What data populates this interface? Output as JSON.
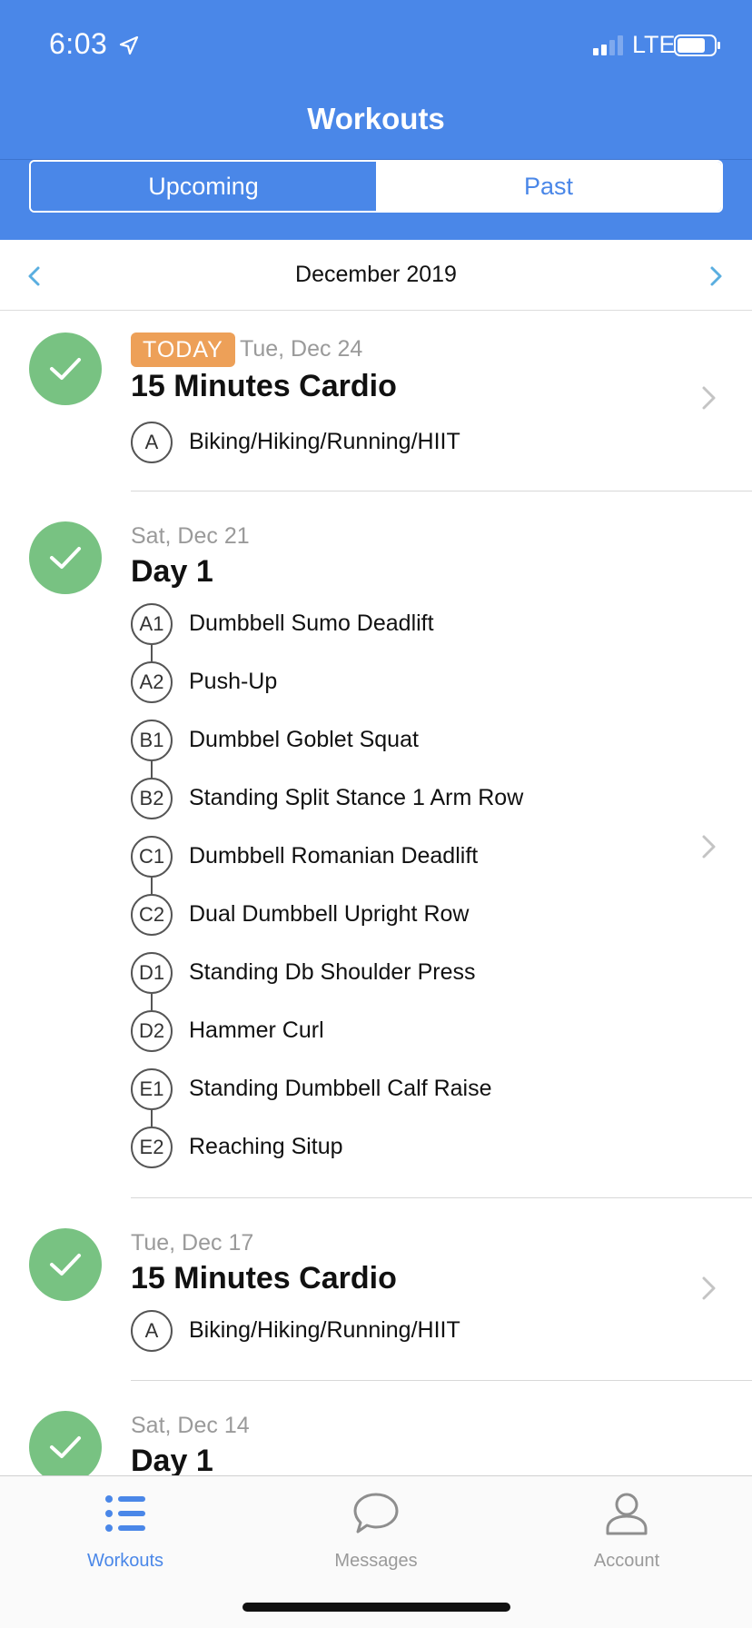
{
  "status_bar": {
    "time": "6:03",
    "network": "LTE"
  },
  "header": {
    "title": "Workouts"
  },
  "segments": {
    "upcoming": "Upcoming",
    "past": "Past"
  },
  "month_nav": {
    "label": "December 2019"
  },
  "workouts": [
    {
      "badge": "TODAY",
      "date": "Tue, Dec 24",
      "title": "15 Minutes Cardio",
      "exercises": [
        {
          "tag": "A",
          "name": "Biking/Hiking/Running/HIIT"
        }
      ]
    },
    {
      "date": "Sat, Dec 21",
      "title": "Day 1",
      "exercises": [
        {
          "tag": "A1",
          "name": "Dumbbell Sumo Deadlift"
        },
        {
          "tag": "A2",
          "name": "Push-Up"
        },
        {
          "tag": "B1",
          "name": "Dumbbel Goblet Squat"
        },
        {
          "tag": "B2",
          "name": "Standing Split Stance 1 Arm Row"
        },
        {
          "tag": "C1",
          "name": "Dumbbell Romanian Deadlift"
        },
        {
          "tag": "C2",
          "name": "Dual Dumbbell Upright Row"
        },
        {
          "tag": "D1",
          "name": "Standing Db Shoulder Press"
        },
        {
          "tag": "D2",
          "name": "Hammer Curl"
        },
        {
          "tag": "E1",
          "name": "Standing Dumbbell Calf Raise"
        },
        {
          "tag": "E2",
          "name": "Reaching Situp"
        }
      ]
    },
    {
      "date": "Tue, Dec 17",
      "title": "15 Minutes Cardio",
      "exercises": [
        {
          "tag": "A",
          "name": "Biking/Hiking/Running/HIIT"
        }
      ]
    },
    {
      "date": "Sat, Dec 14",
      "title": "Day 1",
      "exercises": []
    }
  ],
  "tabbar": {
    "workouts": "Workouts",
    "messages": "Messages",
    "account": "Account"
  },
  "colors": {
    "header_blue": "#4a87e8",
    "check_green": "#78c282",
    "today_orange": "#eda058",
    "nav_arrow": "#5aaee0",
    "inactive_gray": "#9a9a9a"
  }
}
